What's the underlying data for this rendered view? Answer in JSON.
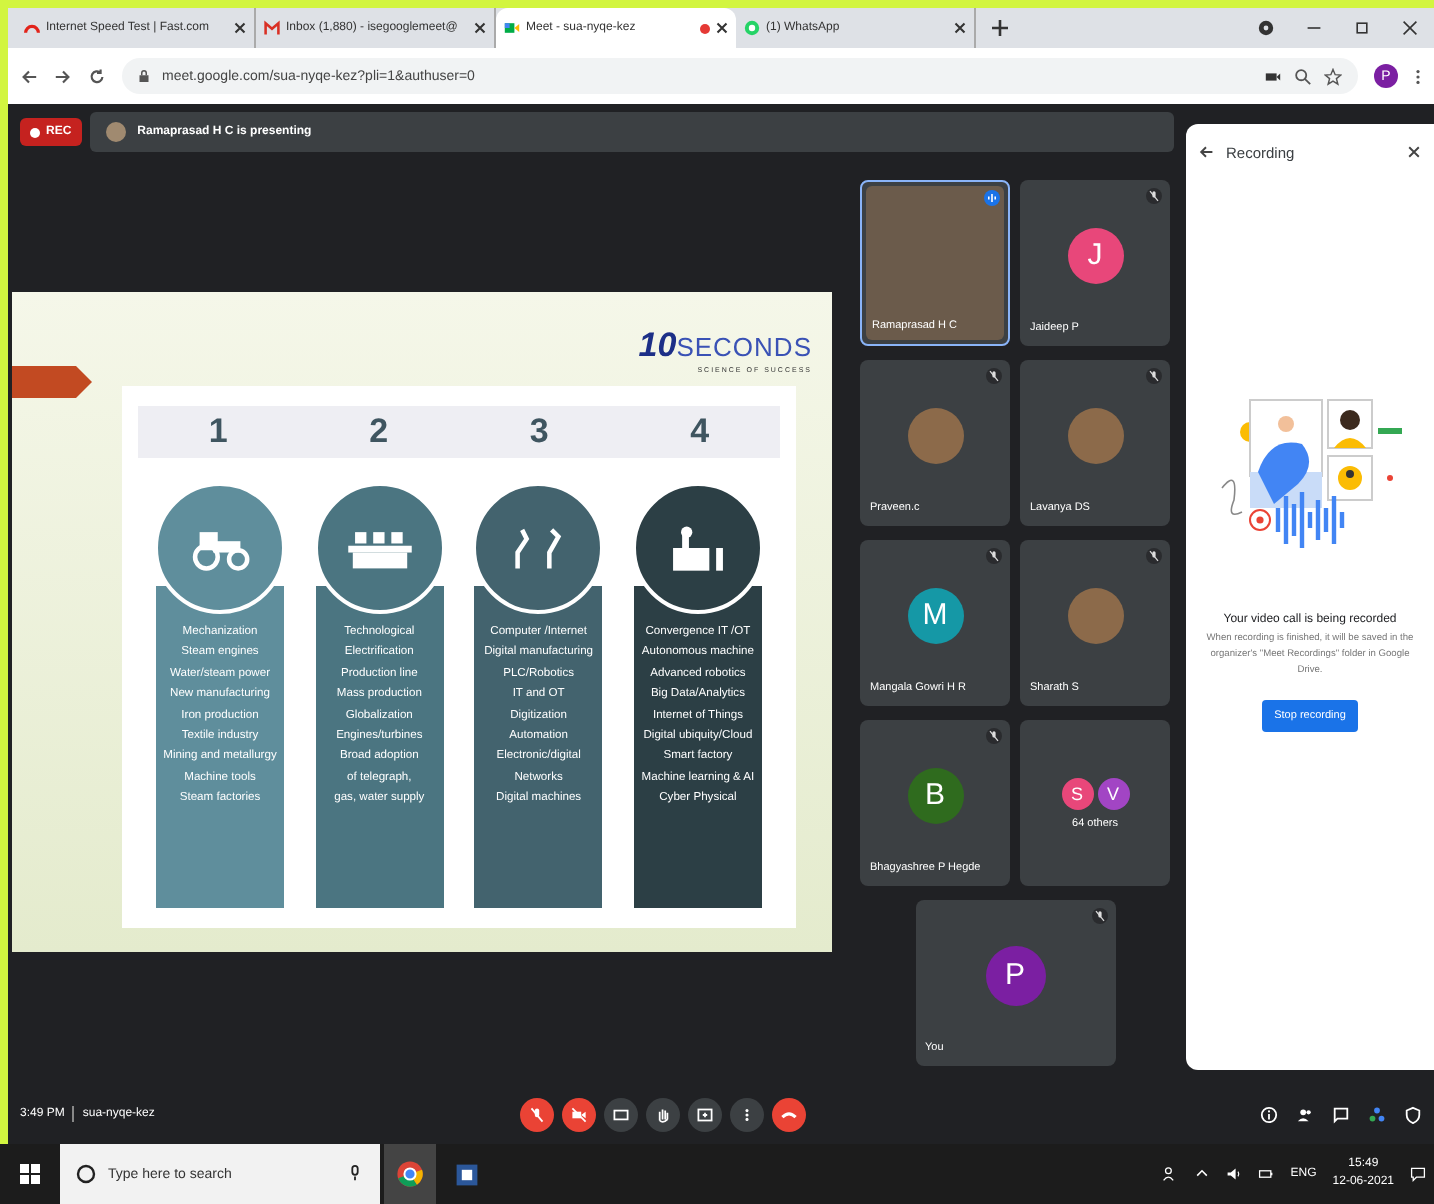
{
  "browser": {
    "tabs": [
      {
        "title": "Internet Speed Test | Fast.com",
        "kind": "speed",
        "selected": false,
        "recording": false
      },
      {
        "title": "Inbox (1,880) - isegooglemeet@",
        "kind": "mail",
        "selected": false,
        "recording": false
      },
      {
        "title": "Meet - sua-nyqe-kez",
        "kind": "meet",
        "selected": true,
        "recording": true
      },
      {
        "title": "(1) WhatsApp",
        "kind": "chat",
        "selected": false,
        "recording": false
      }
    ],
    "url": "meet.google.com/sua-nyqe-kez?pli=1&authuser=0",
    "profile": "P"
  },
  "meet": {
    "rec_label": "REC",
    "presenting": "Ramaprasad H C is presenting",
    "slide": {
      "brand_number": "10",
      "brand_word": "SECONDS",
      "tagline": "SCIENCE OF SUCCESS",
      "columns": [
        {
          "number": "1",
          "color": "#5f8e9c",
          "kind": "tractor",
          "lines": [
            "Mechanization",
            "Steam engines",
            "Water/steam power",
            "New manufacturing",
            "Iron production",
            "Textile industry",
            "Mining and metallurgy",
            "Machine tools",
            "Steam factories"
          ]
        },
        {
          "number": "2",
          "color": "#4b7581",
          "kind": "conveyor",
          "lines": [
            "Technological",
            "Electrification",
            "Production line",
            "Mass production",
            "Globalization",
            "Engines/turbines",
            "Broad adoption",
            "of telegraph,",
            "gas, water supply"
          ]
        },
        {
          "number": "3",
          "color": "#43636e",
          "kind": "robot",
          "lines": [
            "Computer /Internet",
            "Digital manufacturing",
            "PLC/Robotics",
            "IT and OT",
            "Digitization",
            "Automation",
            "Electronic/digital",
            "Networks",
            "Digital machines"
          ]
        },
        {
          "number": "4",
          "color": "#2c3f45",
          "kind": "factory",
          "lines": [
            "Convergence IT /OT",
            "Autonomous machine",
            "Advanced robotics",
            "Big Data/Analytics",
            "Internet of Things",
            "Digital ubiquity/Cloud",
            "Smart factory",
            "Machine learning & AI",
            "Cyber Physical"
          ]
        }
      ]
    },
    "tiles": [
      {
        "kind": "video",
        "name": "Ramaprasad H C",
        "speaking": true,
        "muted": false
      },
      {
        "kind": "letter",
        "initial": "J",
        "color": "#e8477a",
        "name": "Jaideep P",
        "speaking": false,
        "muted": true
      },
      {
        "kind": "photo",
        "name": "Praveen.c",
        "speaking": false,
        "muted": true
      },
      {
        "kind": "photo",
        "name": "Lavanya DS",
        "speaking": false,
        "muted": true
      },
      {
        "kind": "letter",
        "initial": "M",
        "color": "#1598a6",
        "name": "Mangala Gowri H R",
        "speaking": false,
        "muted": true
      },
      {
        "kind": "photo",
        "name": "Sharath S",
        "speaking": false,
        "muted": true
      },
      {
        "kind": "letter",
        "initial": "B",
        "color": "#2f6b1e",
        "name": "Bhagyashree P Hegde",
        "speaking": false,
        "muted": true
      },
      {
        "kind": "others",
        "avatars": [
          {
            "initial": "S",
            "color": "#e8477a"
          },
          {
            "initial": "V",
            "color": "#a245c4"
          }
        ],
        "name": "64 others",
        "speaking": false,
        "muted": false
      },
      {
        "kind": "letter",
        "initial": "P",
        "color": "#7b1fa2",
        "name": "You",
        "speaking": false,
        "muted": true
      }
    ],
    "panel": {
      "title": "Recording",
      "heading": "Your video call is being recorded",
      "text": "When recording is finished, it will be saved in the organizer's \"Meet Recordings\" folder in Google Drive.",
      "button": "Stop recording"
    },
    "footer": {
      "time": "3:49 PM",
      "code": "sua-nyqe-kez",
      "controls": [
        {
          "kind": "mic",
          "off": true
        },
        {
          "kind": "camera",
          "off": true
        },
        {
          "kind": "captions",
          "off": false
        },
        {
          "kind": "hand",
          "off": false
        },
        {
          "kind": "present",
          "off": false
        },
        {
          "kind": "more",
          "off": false
        },
        {
          "kind": "leave"
        }
      ]
    }
  },
  "taskbar": {
    "search_placeholder": "Type here to search",
    "language": "ENG",
    "time": "15:49",
    "date": "12-06-2021"
  }
}
